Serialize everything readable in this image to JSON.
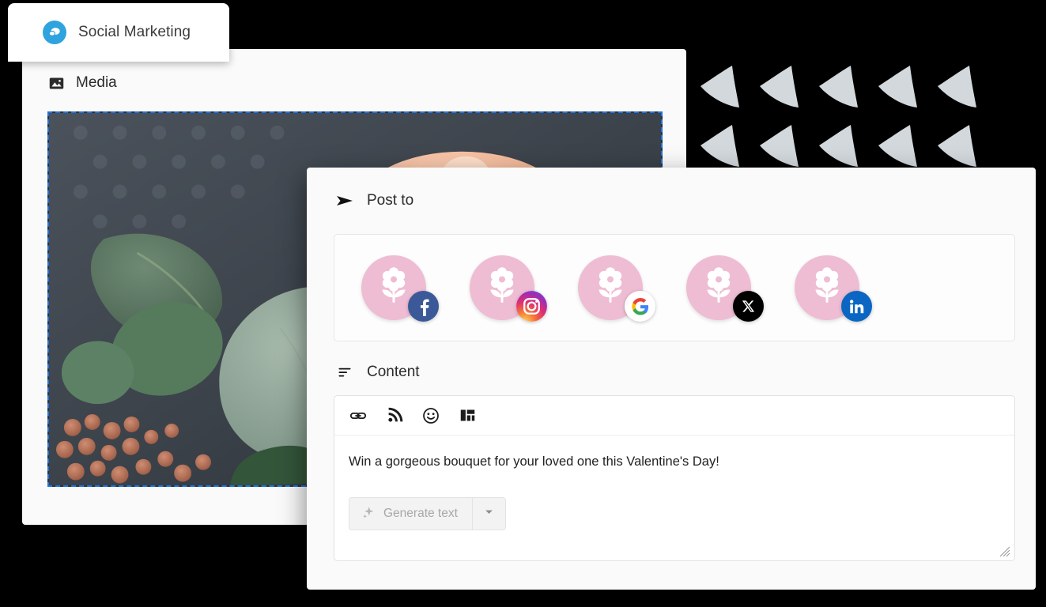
{
  "theme": {
    "canvas_bg": "#000000",
    "panel_bg": "#fafafa",
    "accent_blue": "#2fa3dd",
    "selection_blue": "#1a73e8",
    "avatar_pink": "#eebdd3",
    "arrow_gray": "#d2d8dc",
    "disabled_text": "#a8a8a8"
  },
  "brand": {
    "icon": "chat-bubbles-icon",
    "name": "Social Marketing"
  },
  "media": {
    "icon": "image-icon",
    "label": "Media",
    "selection_border": "dashed blue",
    "photo_alt": "Floral bouquet with eucalyptus leaves, cream ranunculus, peach and orange flowers"
  },
  "post_to": {
    "icon": "send-arrow-icon",
    "label": "Post to",
    "accounts": [
      {
        "avatar": "flower-avatar",
        "platform": "facebook",
        "badge_label": "f",
        "badge_color": "#3b5998"
      },
      {
        "avatar": "flower-avatar",
        "platform": "instagram",
        "badge_label": "",
        "badge_color": "#e1306c"
      },
      {
        "avatar": "flower-avatar",
        "platform": "google",
        "badge_label": "G",
        "badge_color": "#ffffff"
      },
      {
        "avatar": "flower-avatar",
        "platform": "x",
        "badge_label": "X",
        "badge_color": "#000000"
      },
      {
        "avatar": "flower-avatar",
        "platform": "linkedin",
        "badge_label": "in",
        "badge_color": "#0a66c2"
      }
    ]
  },
  "content": {
    "icon": "text-lines-icon",
    "label": "Content",
    "toolbar": [
      {
        "name": "link-icon",
        "title": "Insert link"
      },
      {
        "name": "rss-icon",
        "title": "RSS feed"
      },
      {
        "name": "emoji-icon",
        "title": "Emoji"
      },
      {
        "name": "layout-icon",
        "title": "Template"
      }
    ],
    "text": "Win a gorgeous bouquet for your loved one this Valentine's Day!",
    "generate": {
      "icon": "sparkle-icon",
      "label": "Generate text",
      "disabled": true,
      "dropdown_icon": "chevron-down-icon"
    }
  },
  "decor": {
    "arrows_icon": "cursor-arrow-icon",
    "rows": 2,
    "columns": 5
  }
}
